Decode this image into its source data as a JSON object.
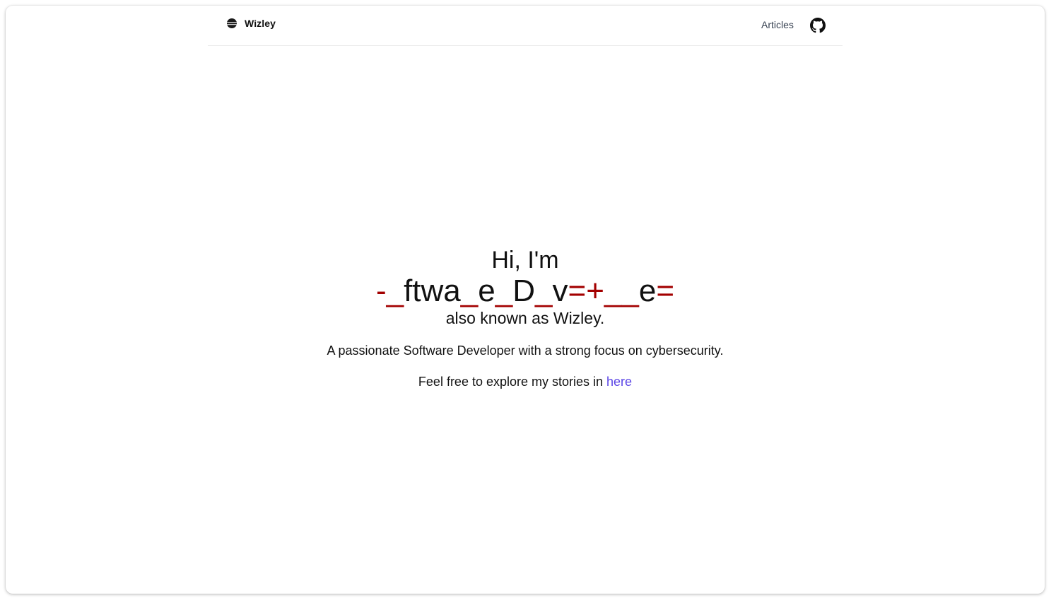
{
  "navbar": {
    "brand_name": "Wizley",
    "brand_icon": "planet-logo-icon",
    "articles_label": "Articles",
    "github_icon": "github-icon"
  },
  "hero": {
    "greeting": "Hi, I'm",
    "scramble_segments": [
      {
        "text": "-_",
        "glitch": true
      },
      {
        "text": "ftwa",
        "glitch": false
      },
      {
        "text": "_",
        "glitch": true
      },
      {
        "text": "e",
        "glitch": false
      },
      {
        "text": "_",
        "glitch": true
      },
      {
        "text": "D",
        "glitch": false
      },
      {
        "text": "_",
        "glitch": true
      },
      {
        "text": "v",
        "glitch": false
      },
      {
        "text": "=+__",
        "glitch": true
      },
      {
        "text": "e",
        "glitch": false
      },
      {
        "text": "=",
        "glitch": true
      }
    ],
    "aka": "also known as Wizley.",
    "tagline": "A passionate Software Developer with a strong focus on cybersecurity.",
    "explore_prefix": "Feel free to explore my stories in ",
    "explore_link": "here"
  },
  "colors": {
    "text": "#111111",
    "glitch": "#a30000",
    "link": "#5b45e6",
    "nav_text": "#374151"
  }
}
